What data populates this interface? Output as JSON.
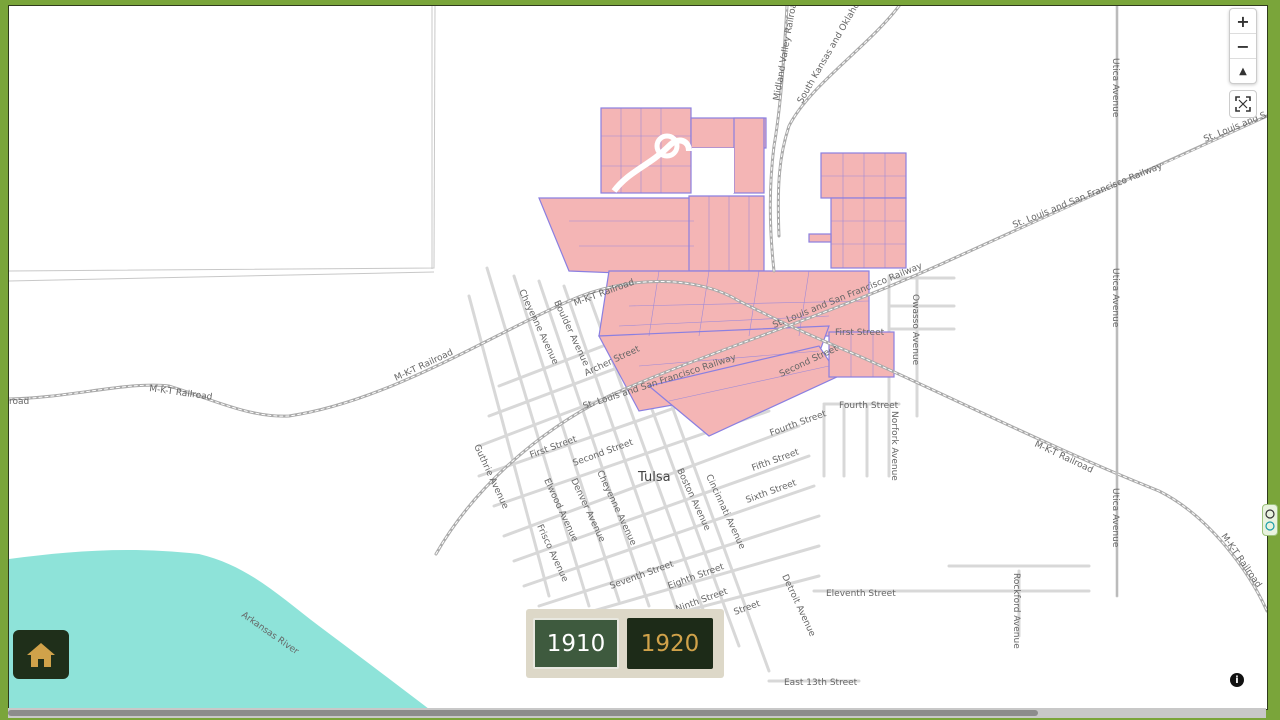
{
  "map": {
    "town_label": "Tulsa",
    "river_label": "Arkansas River",
    "railroads": {
      "mkt": "M-K-T Railroad",
      "mkt_short": "M-K-T Railroad",
      "stl_sf": "St. Louis and San Francisco Railway",
      "midland": "Midland Valley Railroad",
      "sko": "South Kansas and Oklahoma Railroad",
      "stl_edge": "St. Louis and S",
      "mkt_left": "road"
    },
    "streets": {
      "first": "First Street",
      "second": "Second Street",
      "fourth": "Fourth Street",
      "fifth": "Fifth Street",
      "sixth": "Sixth Street",
      "seventh": "Seventh Street",
      "eighth": "Eighth Street",
      "ninth": "Ninth Street",
      "street": "Street",
      "eleventh": "Eleventh Street",
      "east13": "East 13th Street",
      "archer": "Archer Street",
      "cheyenne": "Cheyenne Avenue",
      "boulder": "Boulder Avenue",
      "guthrie": "Guthrie Avenue",
      "elwood": "Elwood Avenue",
      "denver": "Denver Avenue",
      "frisco": "Frisco Avenue",
      "boston": "Boston Avenue",
      "cincinnati": "Cincinnati Avenue",
      "detroit": "Detroit Avenue",
      "owasso": "Owasso Avenue",
      "norfork": "Norfork Avenue",
      "rockford": "Rockford Avenue",
      "utica": "Utica Avenue"
    },
    "colors": {
      "parcel_fill": "#f4b5b5",
      "parcel_stroke": "#8b7fe0",
      "river": "#8ee3d9",
      "street": "#d8d8d8",
      "railroad": "#a8a8a8"
    }
  },
  "controls": {
    "zoom_in": "+",
    "zoom_out": "−",
    "compass": "▲",
    "fullscreen_icon": "fullscreen-icon",
    "info": "i"
  },
  "years": {
    "options": [
      "1910",
      "1920"
    ],
    "selected": "1910"
  },
  "home": {
    "icon": "home-icon"
  }
}
